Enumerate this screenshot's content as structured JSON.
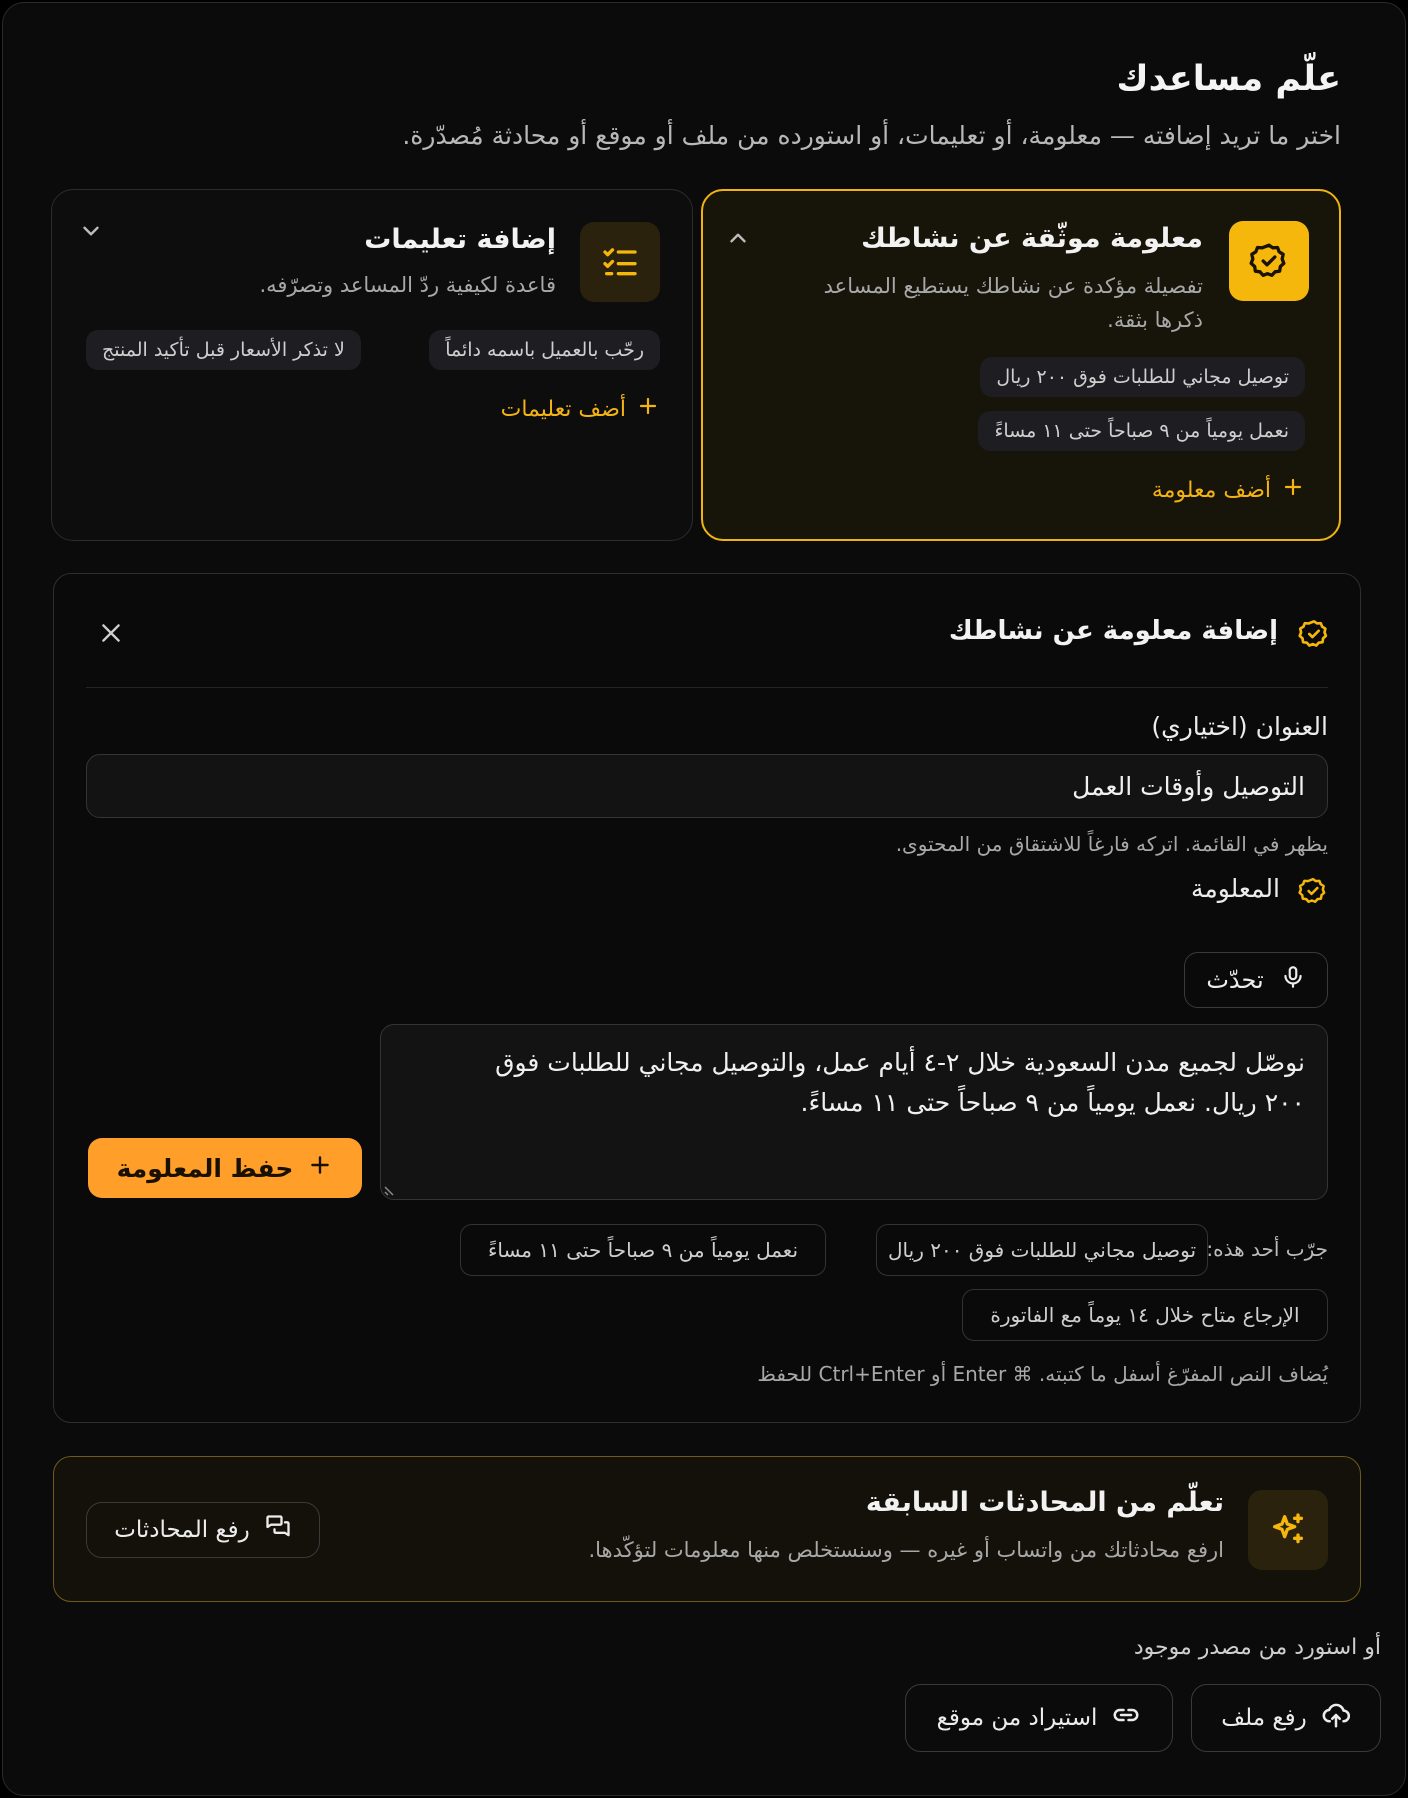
{
  "header": {
    "title": "علّم مساعدك",
    "subtitle": "اختر ما تريد إضافته — معلومة، أو تعليمات، أو استورده من ملف أو موقع أو محادثة مُصدّرة."
  },
  "cards": {
    "knowledge": {
      "title": "معلومة موثّقة عن نشاطك",
      "desc_line1": "تفصيلة مؤكدة عن نشاطك يستطيع المساعد",
      "desc_line2": "ذكرها بثقة.",
      "chips": [
        "توصيل مجاني للطلبات فوق ٢٠٠ ريال",
        "نعمل يومياً من ٩ صباحاً حتى ١١ مساءً"
      ],
      "add_label": "أضف معلومة"
    },
    "instructions": {
      "title": "إضافة تعليمات",
      "desc": "قاعدة لكيفية ردّ المساعد وتصرّفه.",
      "chips": [
        "رحّب بالعميل باسمه دائماً",
        "لا تذكر الأسعار قبل تأكيد المنتج"
      ],
      "add_label": "أضف تعليمات"
    }
  },
  "form": {
    "title": "إضافة معلومة عن نشاطك",
    "title_label": "العنوان (اختياري)",
    "title_value": "التوصيل وأوقات العمل",
    "title_hint": "يظهر في القائمة. اتركه فارغاً للاشتقاق من المحتوى.",
    "content_label": "المعلومة",
    "speak_label": "تحدّث",
    "content_line1": "نوصّل لجميع مدن السعودية خلال ٢-٤ أيام عمل، والتوصيل مجاني للطلبات فوق",
    "content_line2": "٢٠٠ ريال. نعمل يومياً من ٩ صباحاً حتى ١١ مساءً.",
    "save_label": "حفظ المعلومة",
    "try_label": "جرّب أحد هذه:",
    "suggestions": [
      "توصيل مجاني للطلبات فوق ٢٠٠ ريال",
      "نعمل يومياً من ٩ صباحاً حتى ١١ مساءً",
      "الإرجاع متاح خلال ١٤ يوماً مع الفاتورة"
    ],
    "footer_hint": "يُضاف النص المفرّغ أسفل ما كتبته. ⌘ Enter أو Ctrl+Enter للحفظ"
  },
  "learn": {
    "title": "تعلّم من المحادثات السابقة",
    "desc": "ارفع محادثاتك من واتساب أو غيره — وسنستخلص منها معلومات لتؤكّدها.",
    "button_label": "رفع المحادثات"
  },
  "import": {
    "label": "أو استورد من مصدر موجود",
    "upload_label": "رفع ملف",
    "website_label": "استيراد من موقع"
  },
  "colors": {
    "accent": "#f5b70c",
    "save_button": "#ff9f2a",
    "background": "#0b0b0b"
  }
}
